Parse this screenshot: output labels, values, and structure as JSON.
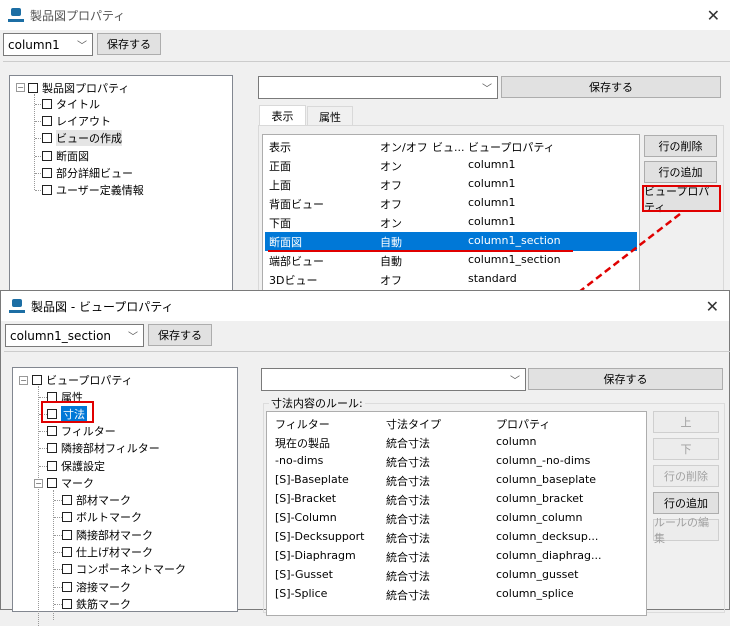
{
  "window1": {
    "title": "製品図プロパティ",
    "preset_select": "column1",
    "save_label": "保存する",
    "tree": {
      "root": "製品図プロパティ",
      "items": [
        "タイトル",
        "レイアウト",
        "ビューの作成",
        "断面図",
        "部分詳細ビュー",
        "ユーザー定義情報"
      ],
      "highlighted": "ビューの作成"
    },
    "right_select": "",
    "right_save_label": "保存する",
    "tabs": [
      {
        "label": "表示",
        "active": true
      },
      {
        "label": "属性",
        "active": false
      }
    ],
    "table": {
      "headers": [
        "表示",
        "オン/オフ",
        "ビュ...",
        "ビュープロパティ"
      ],
      "rows": [
        [
          "正面",
          "オン",
          "",
          "column1"
        ],
        [
          "上面",
          "オフ",
          "",
          "column1"
        ],
        [
          "背面ビュー",
          "オフ",
          "",
          "column1"
        ],
        [
          "下面",
          "オン",
          "",
          "column1"
        ],
        [
          "断面図",
          "自動",
          "",
          "column1_section"
        ],
        [
          "端部ビュー",
          "自動",
          "",
          "column1_section"
        ],
        [
          "3Dビュー",
          "オフ",
          "",
          "standard"
        ]
      ],
      "selected_row": 4
    },
    "buttons": [
      "行の削除",
      "行の追加",
      "ビュープロパティ"
    ]
  },
  "window2": {
    "title": "製品図 - ビュープロパティ",
    "preset_select": "column1_section",
    "save_label": "保存する",
    "tree": {
      "root": "ビュープロパティ",
      "items": [
        "属性",
        "寸法",
        "フィルター",
        "隣接部材フィルター",
        "保護設定"
      ],
      "selected": "寸法",
      "mark_group": "マーク",
      "mark_items": [
        "部材マーク",
        "ボルトマーク",
        "隣接部材マーク",
        "仕上げ材マーク",
        "コンポーネントマーク",
        "溶接マーク",
        "鉄筋マーク"
      ]
    },
    "right_select": "",
    "right_save_label": "保存する",
    "group_label": "寸法内容のルール:",
    "table": {
      "headers": [
        "フィルター",
        "寸法タイプ",
        "プロパティ"
      ],
      "rows": [
        [
          "現在の製品",
          "統合寸法",
          "column"
        ],
        [
          "-no-dims",
          "統合寸法",
          "column_-no-dims"
        ],
        [
          "[S]-Baseplate",
          "統合寸法",
          "column_baseplate"
        ],
        [
          "[S]-Bracket",
          "統合寸法",
          "column_bracket"
        ],
        [
          "[S]-Column",
          "統合寸法",
          "column_column"
        ],
        [
          "[S]-Decksupport",
          "統合寸法",
          "column_decksup..."
        ],
        [
          "[S]-Diaphragm",
          "統合寸法",
          "column_diaphrag..."
        ],
        [
          "[S]-Gusset",
          "統合寸法",
          "column_gusset"
        ],
        [
          "[S]-Splice",
          "統合寸法",
          "column_splice"
        ]
      ]
    },
    "buttons": [
      {
        "label": "上",
        "enabled": false
      },
      {
        "label": "下",
        "enabled": false
      },
      {
        "label": "行の削除",
        "enabled": false
      },
      {
        "label": "行の追加",
        "enabled": true
      },
      {
        "label": "ルールの編集",
        "enabled": false
      }
    ]
  },
  "colors": {
    "selection": "#0078d7",
    "annotation": "#e00000"
  }
}
